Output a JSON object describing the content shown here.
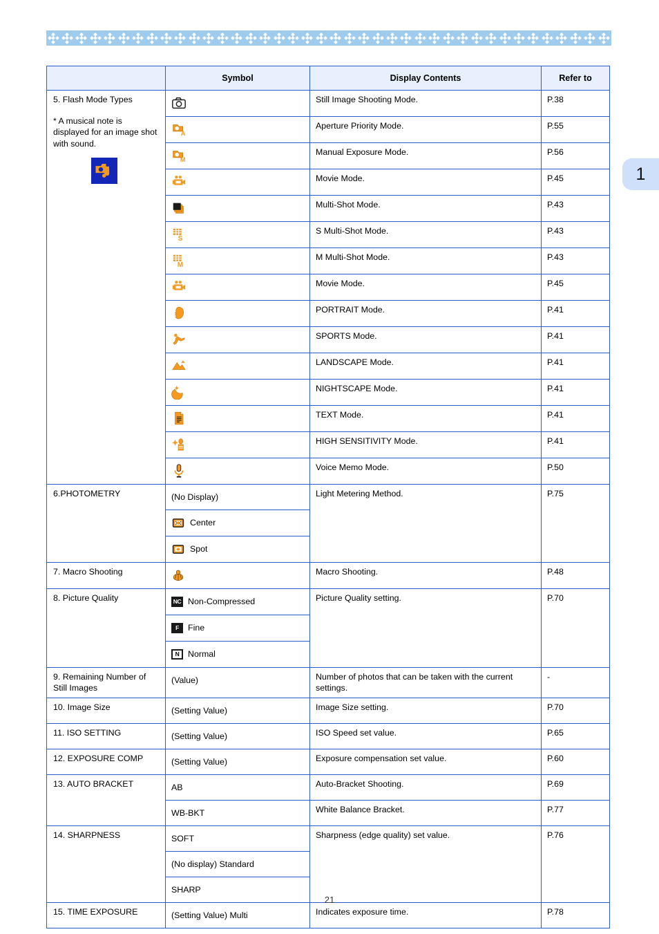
{
  "page": {
    "number": "21",
    "chapter_tab": "1",
    "decoration": "diamond-band"
  },
  "colors": {
    "band": "#9fcbed",
    "tab": "#cfe0fa",
    "table_border": "#2a5bd7",
    "header_fill": "#e8f0fd",
    "icon_orange": "#f59a1e",
    "icon_dark": "#1a1a1a",
    "note_bg": "#1226b8"
  },
  "table": {
    "headers": [
      "",
      "Symbol",
      "Display Contents",
      "Refer to"
    ],
    "groups": [
      {
        "item": "5. Flash Mode Types",
        "note": "* A musical note is displayed for an image shot with sound.",
        "note_icon": "camera-music-note-icon",
        "rows": [
          {
            "symbol_icon": "still-camera-icon",
            "symbol_label": "",
            "display": "Still Image Shooting Mode.",
            "refer": "P.38"
          },
          {
            "symbol_icon": "camera-aperture-a-icon",
            "symbol_label": "",
            "display": "Aperture Priority Mode.",
            "refer": "P.55"
          },
          {
            "symbol_icon": "camera-manual-m-icon",
            "symbol_label": "",
            "display": "Manual Exposure Mode.",
            "refer": "P.56"
          },
          {
            "symbol_icon": "movie-camera-icon",
            "symbol_label": "",
            "display": "Movie Mode.",
            "refer": "P.45"
          },
          {
            "symbol_icon": "multi-shot-icon",
            "symbol_label": "",
            "display": "Multi-Shot Mode.",
            "refer": "P.43"
          },
          {
            "symbol_icon": "s-multi-shot-icon",
            "symbol_label": "",
            "display": "S Multi-Shot Mode.",
            "refer": "P.43"
          },
          {
            "symbol_icon": "m-multi-shot-icon",
            "symbol_label": "",
            "display": "M Multi-Shot Mode.",
            "refer": "P.43"
          },
          {
            "symbol_icon": "movie-camera-icon",
            "symbol_label": "",
            "display": "Movie Mode.",
            "refer": "P.45"
          },
          {
            "symbol_icon": "portrait-icon",
            "symbol_label": "",
            "display": "PORTRAIT Mode.",
            "refer": "P.41"
          },
          {
            "symbol_icon": "sports-icon",
            "symbol_label": "",
            "display": "SPORTS Mode.",
            "refer": "P.41"
          },
          {
            "symbol_icon": "landscape-icon",
            "symbol_label": "",
            "display": "LANDSCAPE Mode.",
            "refer": "P.41"
          },
          {
            "symbol_icon": "nightscape-icon",
            "symbol_label": "",
            "display": "NIGHTSCAPE Mode.",
            "refer": "P.41"
          },
          {
            "symbol_icon": "text-document-icon",
            "symbol_label": "",
            "display": "TEXT Mode.",
            "refer": "P.41"
          },
          {
            "symbol_icon": "high-sensitivity-icon",
            "symbol_label": "",
            "display": "HIGH SENSITIVITY Mode.",
            "refer": "P.41"
          },
          {
            "symbol_icon": "microphone-icon",
            "symbol_label": "",
            "display": "Voice Memo Mode.",
            "refer": "P.50"
          }
        ]
      },
      {
        "item": "6.PHOTOMETRY",
        "display": "Light Metering Method.",
        "refer": "P.75",
        "symbols": [
          {
            "icon": "",
            "label": "(No Display)"
          },
          {
            "icon": "metering-center-icon",
            "label": "Center"
          },
          {
            "icon": "metering-spot-icon",
            "label": "Spot"
          }
        ]
      },
      {
        "item": "7. Macro Shooting",
        "display": "Macro Shooting.",
        "refer": "P.48",
        "symbols": [
          {
            "icon": "macro-flower-icon",
            "label": ""
          }
        ]
      },
      {
        "item": "8. Picture Quality",
        "display": "Picture Quality setting.",
        "refer": "P.70",
        "symbols": [
          {
            "icon": "quality-nc-badge",
            "label": "Non-Compressed"
          },
          {
            "icon": "quality-f-badge",
            "label": "Fine"
          },
          {
            "icon": "quality-n-badge",
            "label": "Normal"
          }
        ]
      },
      {
        "item": "9. Remaining Number of Still Images",
        "display": "Number of photos that can be taken with the current settings.",
        "refer": "-",
        "symbols": [
          {
            "icon": "",
            "label": "(Value)"
          }
        ]
      },
      {
        "item": "10. Image Size",
        "display": "Image Size setting.",
        "refer": "P.70",
        "symbols": [
          {
            "icon": "",
            "label": "(Setting Value)"
          }
        ]
      },
      {
        "item": "11. ISO SETTING",
        "display": "ISO Speed set value.",
        "refer": "P.65",
        "symbols": [
          {
            "icon": "",
            "label": "(Setting Value)"
          }
        ]
      },
      {
        "item": "12. EXPOSURE COMP",
        "display": "Exposure compensation set value.",
        "refer": "P.60",
        "symbols": [
          {
            "icon": "",
            "label": "(Setting Value)"
          }
        ]
      },
      {
        "item": "13. AUTO BRACKET",
        "rows": [
          {
            "symbol_icon": "",
            "symbol_label": "AB",
            "display": "Auto-Bracket Shooting.",
            "refer": "P.69"
          },
          {
            "symbol_icon": "",
            "symbol_label": "WB-BKT",
            "display": "White Balance Bracket.",
            "refer": "P.77"
          }
        ]
      },
      {
        "item": "14. SHARPNESS",
        "display": "Sharpness (edge quality) set value.",
        "refer": "P.76",
        "symbols": [
          {
            "icon": "",
            "label": "SOFT"
          },
          {
            "icon": "",
            "label": "(No display) Standard"
          },
          {
            "icon": "",
            "label": "SHARP"
          }
        ]
      },
      {
        "item": "15. TIME EXPOSURE",
        "display": "Indicates exposure time.",
        "refer": "P.78",
        "symbols": [
          {
            "icon": "",
            "label": "(Setting Value) Multi"
          }
        ]
      }
    ]
  }
}
